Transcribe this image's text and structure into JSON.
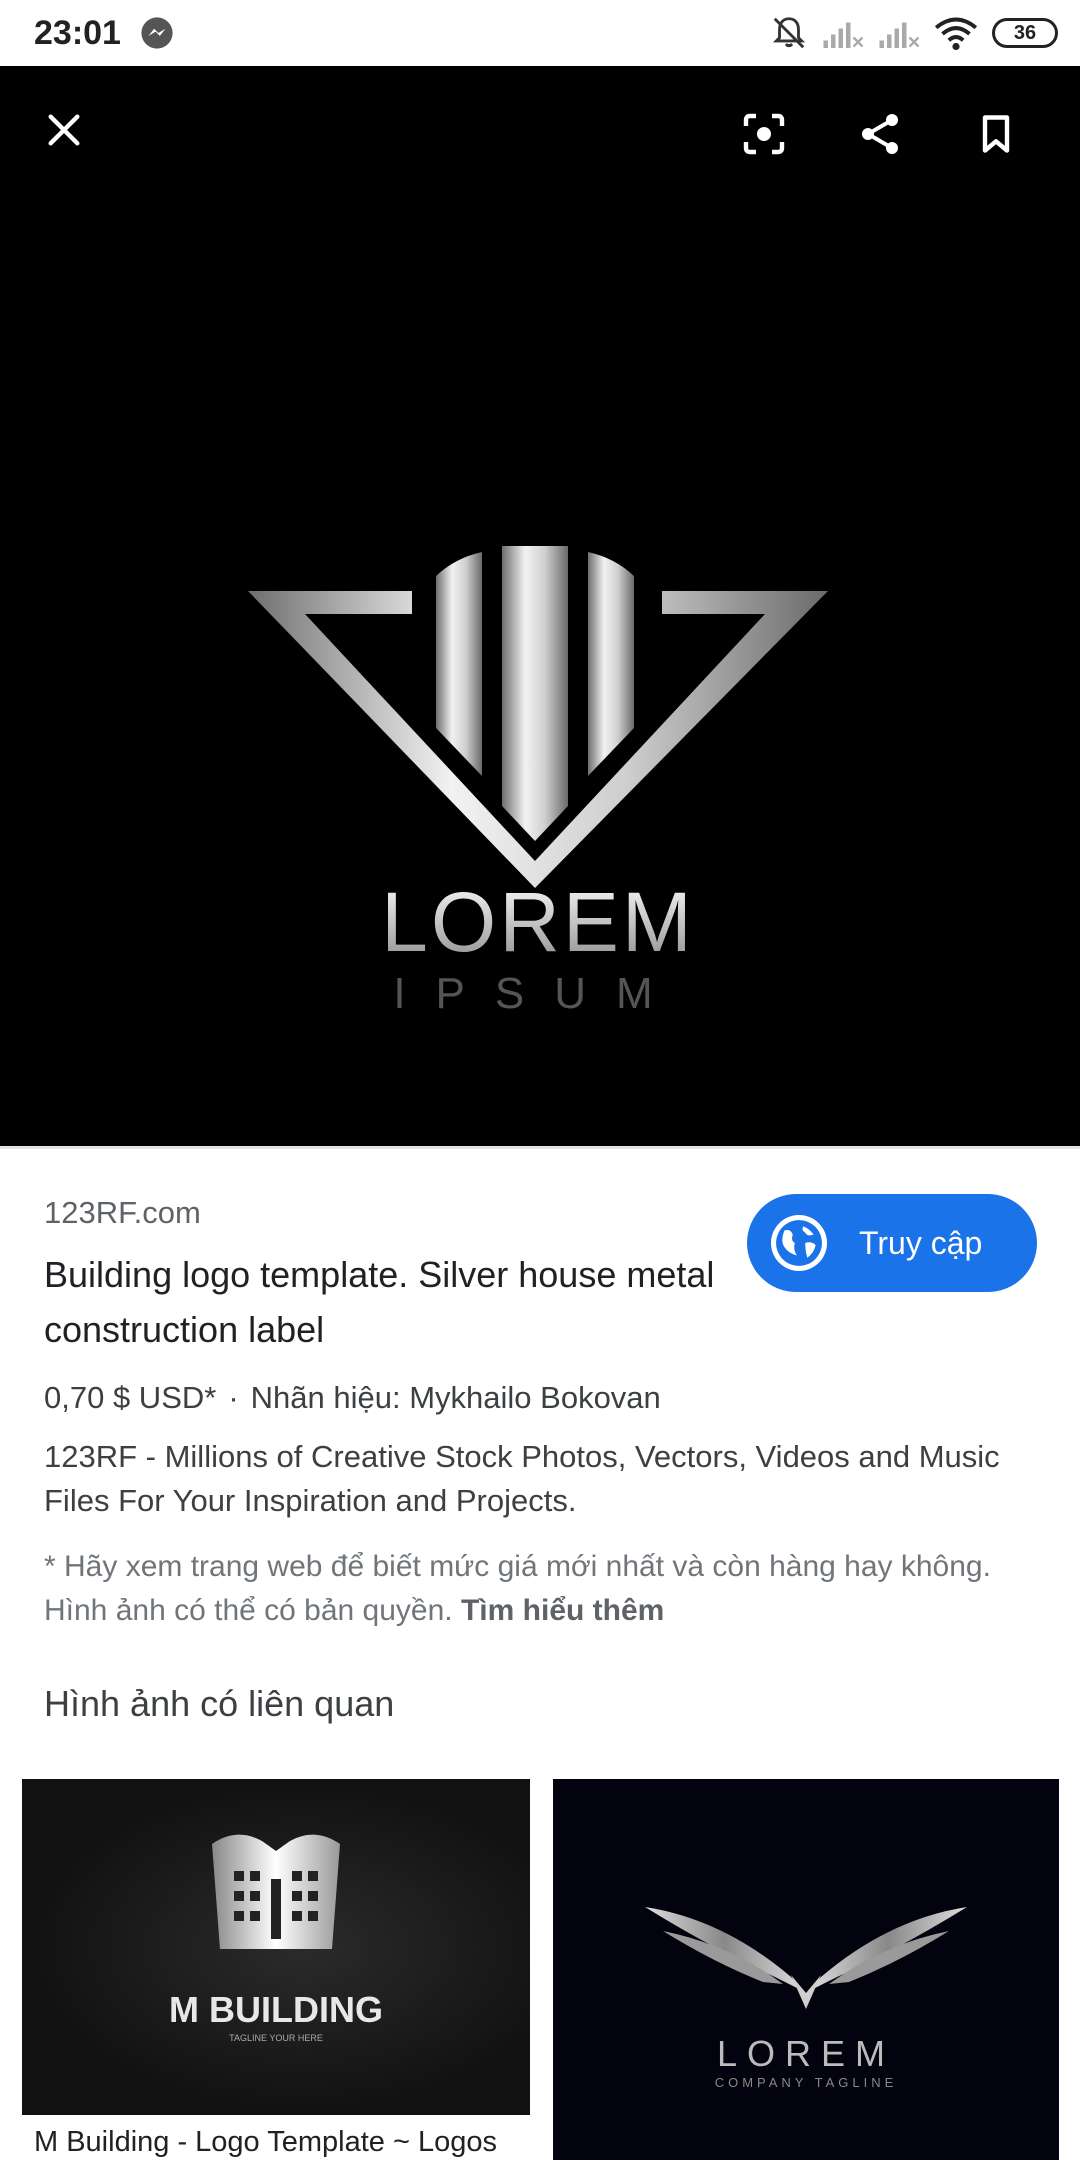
{
  "status_bar": {
    "time": "23:01",
    "battery": "36",
    "icons": [
      "messenger-icon",
      "bell-muted-icon",
      "signal-icon",
      "signal-icon",
      "wifi-icon",
      "battery-icon"
    ]
  },
  "viewer": {
    "close_icon": "close-icon",
    "lens_icon": "lens-icon",
    "share_icon": "share-icon",
    "bookmark_icon": "bookmark-icon",
    "image_text_main": "LOREM",
    "image_text_sub": "IPSUM"
  },
  "result": {
    "source": "123RF.com",
    "title": "Building logo template. Silver house metal construction label",
    "visit_label": "Truy cập",
    "price": "0,70 $ USD*",
    "brand": "Nhãn hiệu: Mykhailo Bokovan",
    "description": "123RF - Millions of Creative Stock Photos, Vectors, Videos and Music Files For Your Inspiration and Projects.",
    "disclaimer": "* Hãy xem trang web để biết mức giá mới nhất và còn hàng hay không. Hình ảnh có thể có bản quyền.",
    "learn_more": "Tìm hiểu thêm"
  },
  "related": {
    "heading": "Hình ảnh có liên quan",
    "items": [
      {
        "caption": "M Building - Logo Template ~ Logos",
        "logo_text": "M BUILDING",
        "tagline": "TAGLINE YOUR HERE"
      },
      {
        "caption": "",
        "logo_text": "LOREM",
        "tagline": "COMPANY TAGLINE"
      }
    ]
  },
  "colors": {
    "accent": "#1a73e8",
    "viewer_bg": "#000000"
  }
}
